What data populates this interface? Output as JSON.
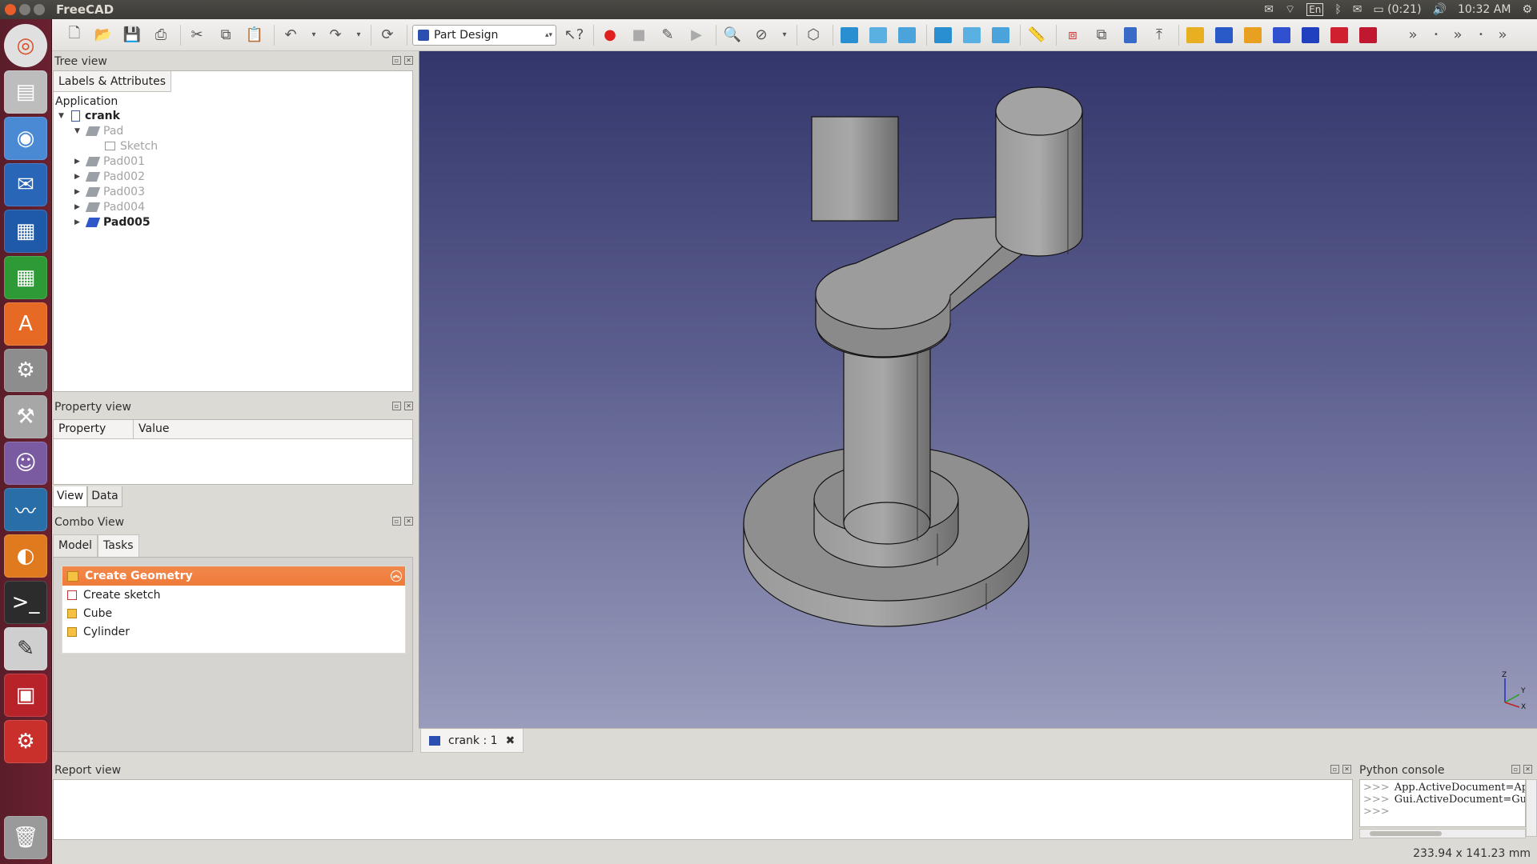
{
  "topbar": {
    "app_title": "FreeCAD",
    "lang": "En",
    "battery": "(0:21)",
    "time": "10:32 AM"
  },
  "toolbar": {
    "workbench": "Part Design"
  },
  "tree_view": {
    "title": "Tree view",
    "tab": "Labels & Attributes",
    "root": "Application",
    "items": [
      {
        "label": "crank"
      },
      {
        "label": "Pad"
      },
      {
        "label": "Sketch"
      },
      {
        "label": "Pad001"
      },
      {
        "label": "Pad002"
      },
      {
        "label": "Pad003"
      },
      {
        "label": "Pad004"
      },
      {
        "label": "Pad005"
      }
    ]
  },
  "property_view": {
    "title": "Property view",
    "col_property": "Property",
    "col_value": "Value",
    "tab_view": "View",
    "tab_data": "Data"
  },
  "combo_view": {
    "title": "Combo View",
    "tab_model": "Model",
    "tab_tasks": "Tasks",
    "task_title": "Create Geometry",
    "tasks": [
      "Create sketch",
      "Cube",
      "Cylinder"
    ]
  },
  "document_tab": {
    "label": "crank : 1"
  },
  "report_view": {
    "title": "Report view"
  },
  "python_console": {
    "title": "Python console",
    "lines": [
      "App.ActiveDocument=App.",
      "Gui.ActiveDocument=Gui.g",
      ""
    ],
    "prompt": ">>>"
  },
  "status": {
    "dimensions": "233.94 x 141.23 mm"
  },
  "axis_labels": {
    "z": "Z",
    "y": "Y",
    "x": "X"
  },
  "colors": {
    "task_header": "#ef7a38",
    "viewport_top": "#33366b",
    "viewport_bottom": "#9a9cbc"
  }
}
